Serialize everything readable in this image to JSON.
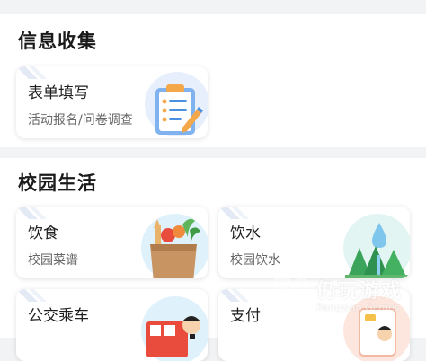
{
  "sections": [
    {
      "title": "信息收集",
      "cards": [
        {
          "title": "表单填写",
          "subtitle": "活动报名/问卷调查",
          "icon": "clipboard-form-icon"
        }
      ]
    },
    {
      "title": "校园生活",
      "cards": [
        {
          "title": "饮食",
          "subtitle": "校园菜谱",
          "icon": "grocery-bag-icon"
        },
        {
          "title": "饮水",
          "subtitle": "校园饮水",
          "icon": "water-drop-forest-icon"
        },
        {
          "title": "公交乘车",
          "subtitle": "",
          "icon": "bus-driver-icon"
        },
        {
          "title": "支付",
          "subtitle": "",
          "icon": "payment-card-icon"
        }
      ]
    }
  ],
  "watermark": {
    "text": "仍玩游戏",
    "subtext": "Rengwan Games"
  },
  "colors": {
    "background": "#f2f3f5",
    "card": "#ffffff",
    "accent_blue": "#4a90e2"
  }
}
